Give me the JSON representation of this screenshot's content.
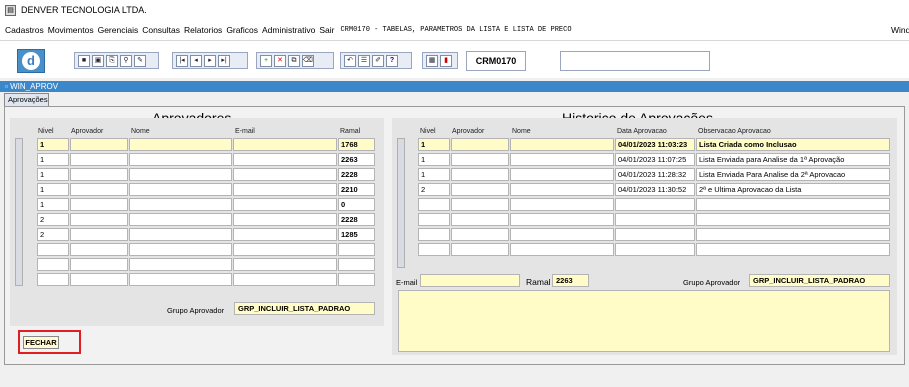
{
  "app": {
    "title": "DENVER TECNOLOGIA LTDA."
  },
  "menu": {
    "items": [
      "Cadastros",
      "Movimentos",
      "Gerenciais",
      "Consultas",
      "Relatorios",
      "Graficos",
      "Administrativo",
      "Sair"
    ],
    "form_caption": "CRM0170 - TABELAS, PARAMETROS DA LISTA E LISTA DE PRECO",
    "right_text": "Windo"
  },
  "toolbar": {
    "form_code": "CRM0170"
  },
  "window": {
    "title": "WIN_APROV",
    "tab": "Aprovações"
  },
  "aprovadores": {
    "title": "Aprovadores",
    "headers": [
      "Nivel",
      "Aprovador",
      "Nome",
      "E-mail",
      "Ramal"
    ],
    "rows": [
      {
        "nivel": "1",
        "aprovador": "",
        "nome": "",
        "email": "",
        "ramal": "1768"
      },
      {
        "nivel": "1",
        "aprovador": "",
        "nome": "",
        "email": "",
        "ramal": "2263"
      },
      {
        "nivel": "1",
        "aprovador": "",
        "nome": "",
        "email": "",
        "ramal": "2228"
      },
      {
        "nivel": "1",
        "aprovador": "",
        "nome": "",
        "email": "",
        "ramal": "2210"
      },
      {
        "nivel": "1",
        "aprovador": "",
        "nome": "",
        "email": "",
        "ramal": "0"
      },
      {
        "nivel": "2",
        "aprovador": "",
        "nome": "",
        "email": "",
        "ramal": "2228"
      },
      {
        "nivel": "2",
        "aprovador": "",
        "nome": "",
        "email": "",
        "ramal": "1285"
      },
      {
        "nivel": "",
        "aprovador": "",
        "nome": "",
        "email": "",
        "ramal": ""
      },
      {
        "nivel": "",
        "aprovador": "",
        "nome": "",
        "email": "",
        "ramal": ""
      },
      {
        "nivel": "",
        "aprovador": "",
        "nome": "",
        "email": "",
        "ramal": ""
      }
    ],
    "grupo_label": "Grupo Aprovador",
    "grupo_value": "GRP_INCLUIR_LISTA_PADRAO"
  },
  "historico": {
    "title": "Historico de Aprovações",
    "headers": [
      "Nivel",
      "Aprovador",
      "Nome",
      "Data Aprovacao",
      "Observacao Aprovacao"
    ],
    "rows": [
      {
        "nivel": "1",
        "aprovador": "",
        "nome": "",
        "data": "04/01/2023 11:03:23",
        "obs": "Lista Criada como Inclusao"
      },
      {
        "nivel": "1",
        "aprovador": "",
        "nome": "",
        "data": "04/01/2023 11:07:25",
        "obs": "Lista Enviada para Analise da 1ª Aprovação"
      },
      {
        "nivel": "1",
        "aprovador": "",
        "nome": "",
        "data": "04/01/2023 11:28:32",
        "obs": "Lista Enviada Para Analise da 2ª Aprovacao"
      },
      {
        "nivel": "2",
        "aprovador": "",
        "nome": "",
        "data": "04/01/2023 11:30:52",
        "obs": "2ª e Ultima Aprovacao da Lista"
      },
      {
        "nivel": "",
        "aprovador": "",
        "nome": "",
        "data": "",
        "obs": ""
      },
      {
        "nivel": "",
        "aprovador": "",
        "nome": "",
        "data": "",
        "obs": ""
      },
      {
        "nivel": "",
        "aprovador": "",
        "nome": "",
        "data": "",
        "obs": ""
      },
      {
        "nivel": "",
        "aprovador": "",
        "nome": "",
        "data": "",
        "obs": ""
      }
    ],
    "email_label": "E-mail",
    "email_value": "",
    "ramal_label": "Ramal",
    "ramal_value": "2263",
    "grupo_label": "Grupo Aprovador",
    "grupo_value": "GRP_INCLUIR_LISTA_PADRAO"
  },
  "buttons": {
    "fechar": "FECHAR"
  }
}
